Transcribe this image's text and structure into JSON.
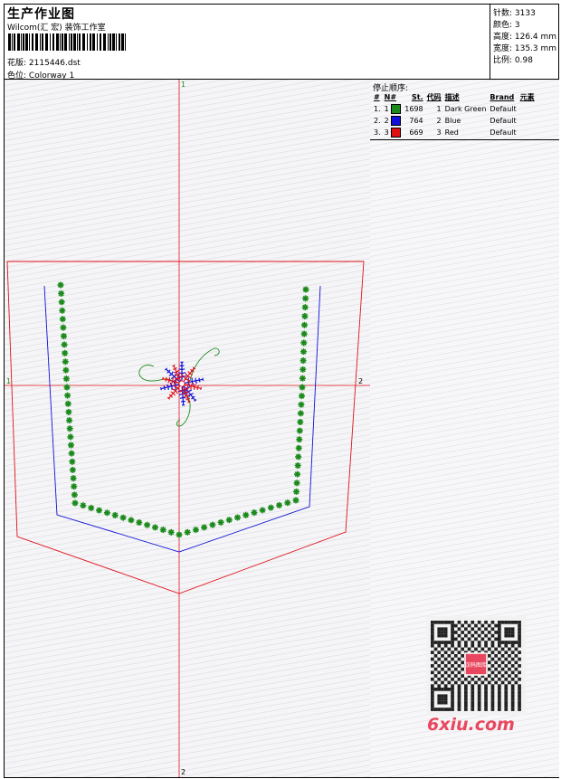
{
  "header": {
    "title": "生产作业图",
    "studio": "Wilcom(汇 宏) 装饰工作室",
    "design_label": "花版:",
    "design_value": "2115446.dst",
    "colorway_label": "色位:",
    "colorway_value": "Colorway 1"
  },
  "stats": {
    "stitches": "针数: 3133",
    "colors": "颜色: 3",
    "height": "高度: 126.4 mm",
    "width": "宽度: 135.3 mm",
    "scale": "比例: 0.98"
  },
  "canvas": {
    "axis_top": "1",
    "axis_left": "1",
    "axis_right": "2",
    "axis_bottom": "2"
  },
  "stop_sequence": {
    "title": "停止顺序:",
    "headers": [
      "#",
      "N#",
      "St.",
      "代码",
      "描述",
      "Brand",
      "元素"
    ],
    "rows": [
      {
        "idx": "1.",
        "n": "1",
        "color": "#1a8a1a",
        "st": "1698",
        "code": "1",
        "desc": "Dark Green",
        "brand": "Default"
      },
      {
        "idx": "2.",
        "n": "2",
        "color": "#1010d8",
        "st": "764",
        "code": "2",
        "desc": "Blue",
        "brand": "Default"
      },
      {
        "idx": "3.",
        "n": "3",
        "color": "#e01010",
        "st": "669",
        "code": "3",
        "desc": "Red",
        "brand": "Default"
      }
    ]
  },
  "watermark": {
    "qr_label": "汉码图库",
    "site": "6xiu.com"
  }
}
